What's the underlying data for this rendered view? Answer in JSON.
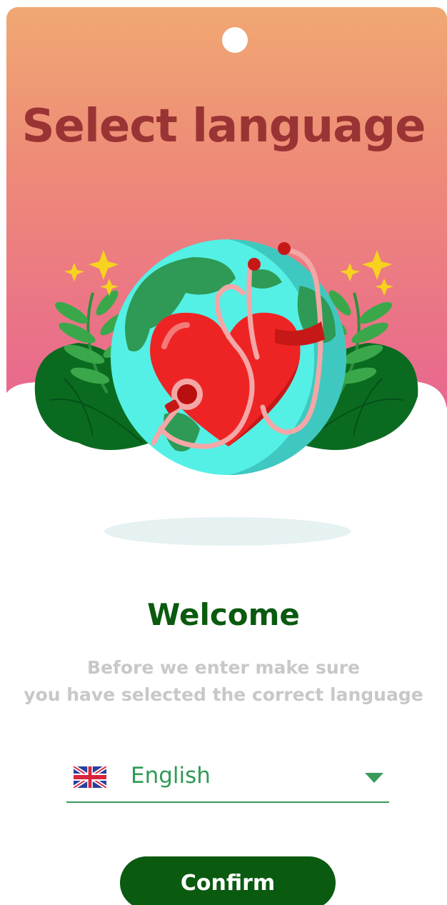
{
  "header": {
    "title": "Select language"
  },
  "welcome": {
    "heading": "Welcome",
    "subtitle_line1": "Before we enter make sure",
    "subtitle_line2": "you have selected the correct language"
  },
  "language_selector": {
    "selected_value": "English",
    "flag_icon": "uk-flag-icon",
    "dropdown_icon": "chevron-down-icon"
  },
  "actions": {
    "confirm_label": "Confirm"
  },
  "colors": {
    "gradient_top": "#f0a872",
    "gradient_bottom": "#e8678f",
    "title": "#9a3434",
    "primary": "#0a5a10",
    "accent": "#2f9a55",
    "muted_text": "#c8c8c8"
  },
  "illustration": {
    "description_icons": [
      "globe-icon",
      "heart-icon",
      "stethoscope-icon",
      "leaf-icon",
      "sparkle-icon",
      "cloud-icon"
    ]
  }
}
